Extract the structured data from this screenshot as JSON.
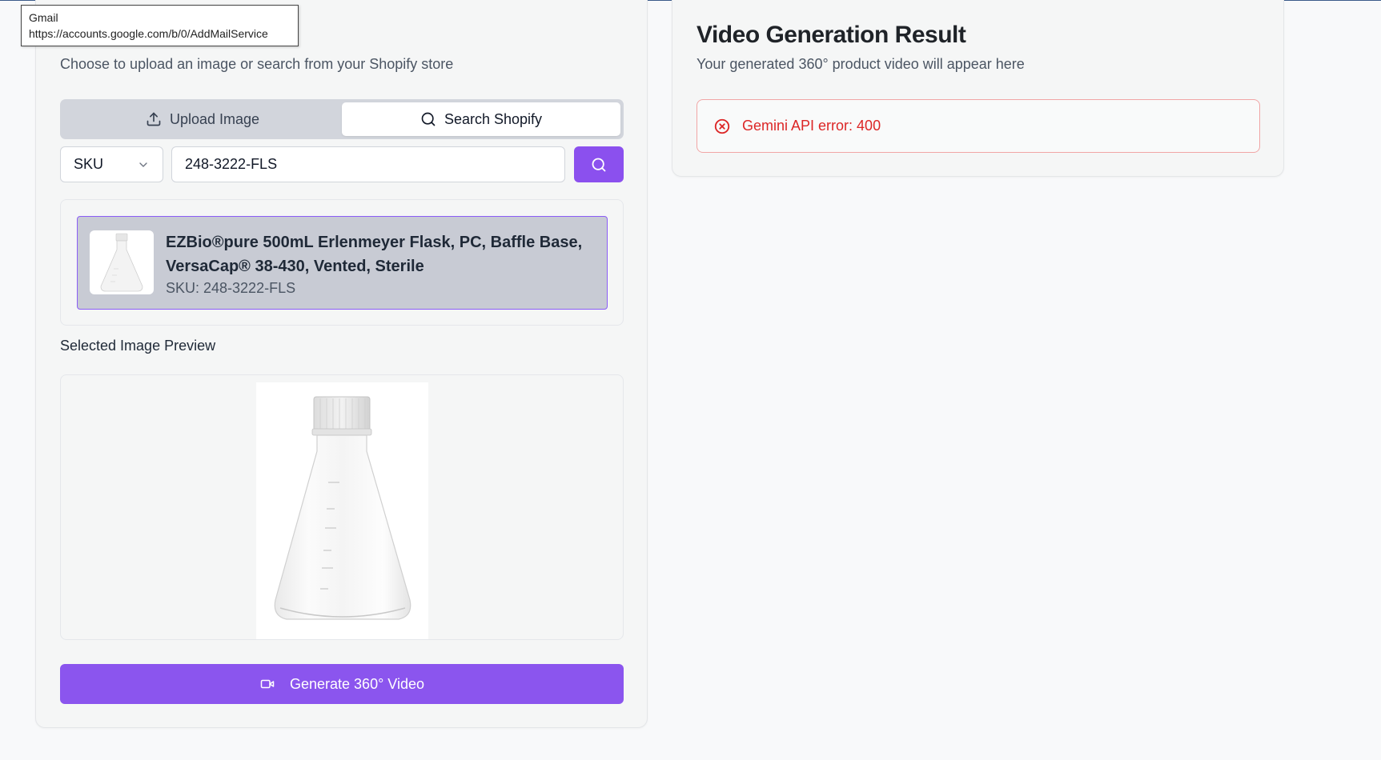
{
  "tooltip": {
    "title": "Gmail",
    "url": "https://accounts.google.com/b/0/AddMailService"
  },
  "left": {
    "subtitle": "Choose to upload an image or search from your Shopify store",
    "tabs": [
      {
        "label": "Upload Image",
        "icon": "upload-icon",
        "active": false
      },
      {
        "label": "Search Shopify",
        "icon": "search-icon",
        "active": true
      }
    ],
    "search": {
      "field_selected": "SKU",
      "query": "248-3222-FLS"
    },
    "result": {
      "title": "EZBio®pure 500mL Erlenmeyer Flask, PC, Baffle Base, VersaCap® 38-430, Vented, Sterile",
      "sku": "SKU: 248-3222-FLS"
    },
    "preview_label": "Selected Image Preview",
    "generate_label": "Generate 360° Video"
  },
  "right": {
    "title": "Video Generation Result",
    "subtitle": "Your generated 360° product video will appear here",
    "error": "Gemini API error: 400"
  },
  "colors": {
    "accent": "#8b55ee",
    "error": "#dc2626",
    "selected_border": "#8b5cf6"
  }
}
